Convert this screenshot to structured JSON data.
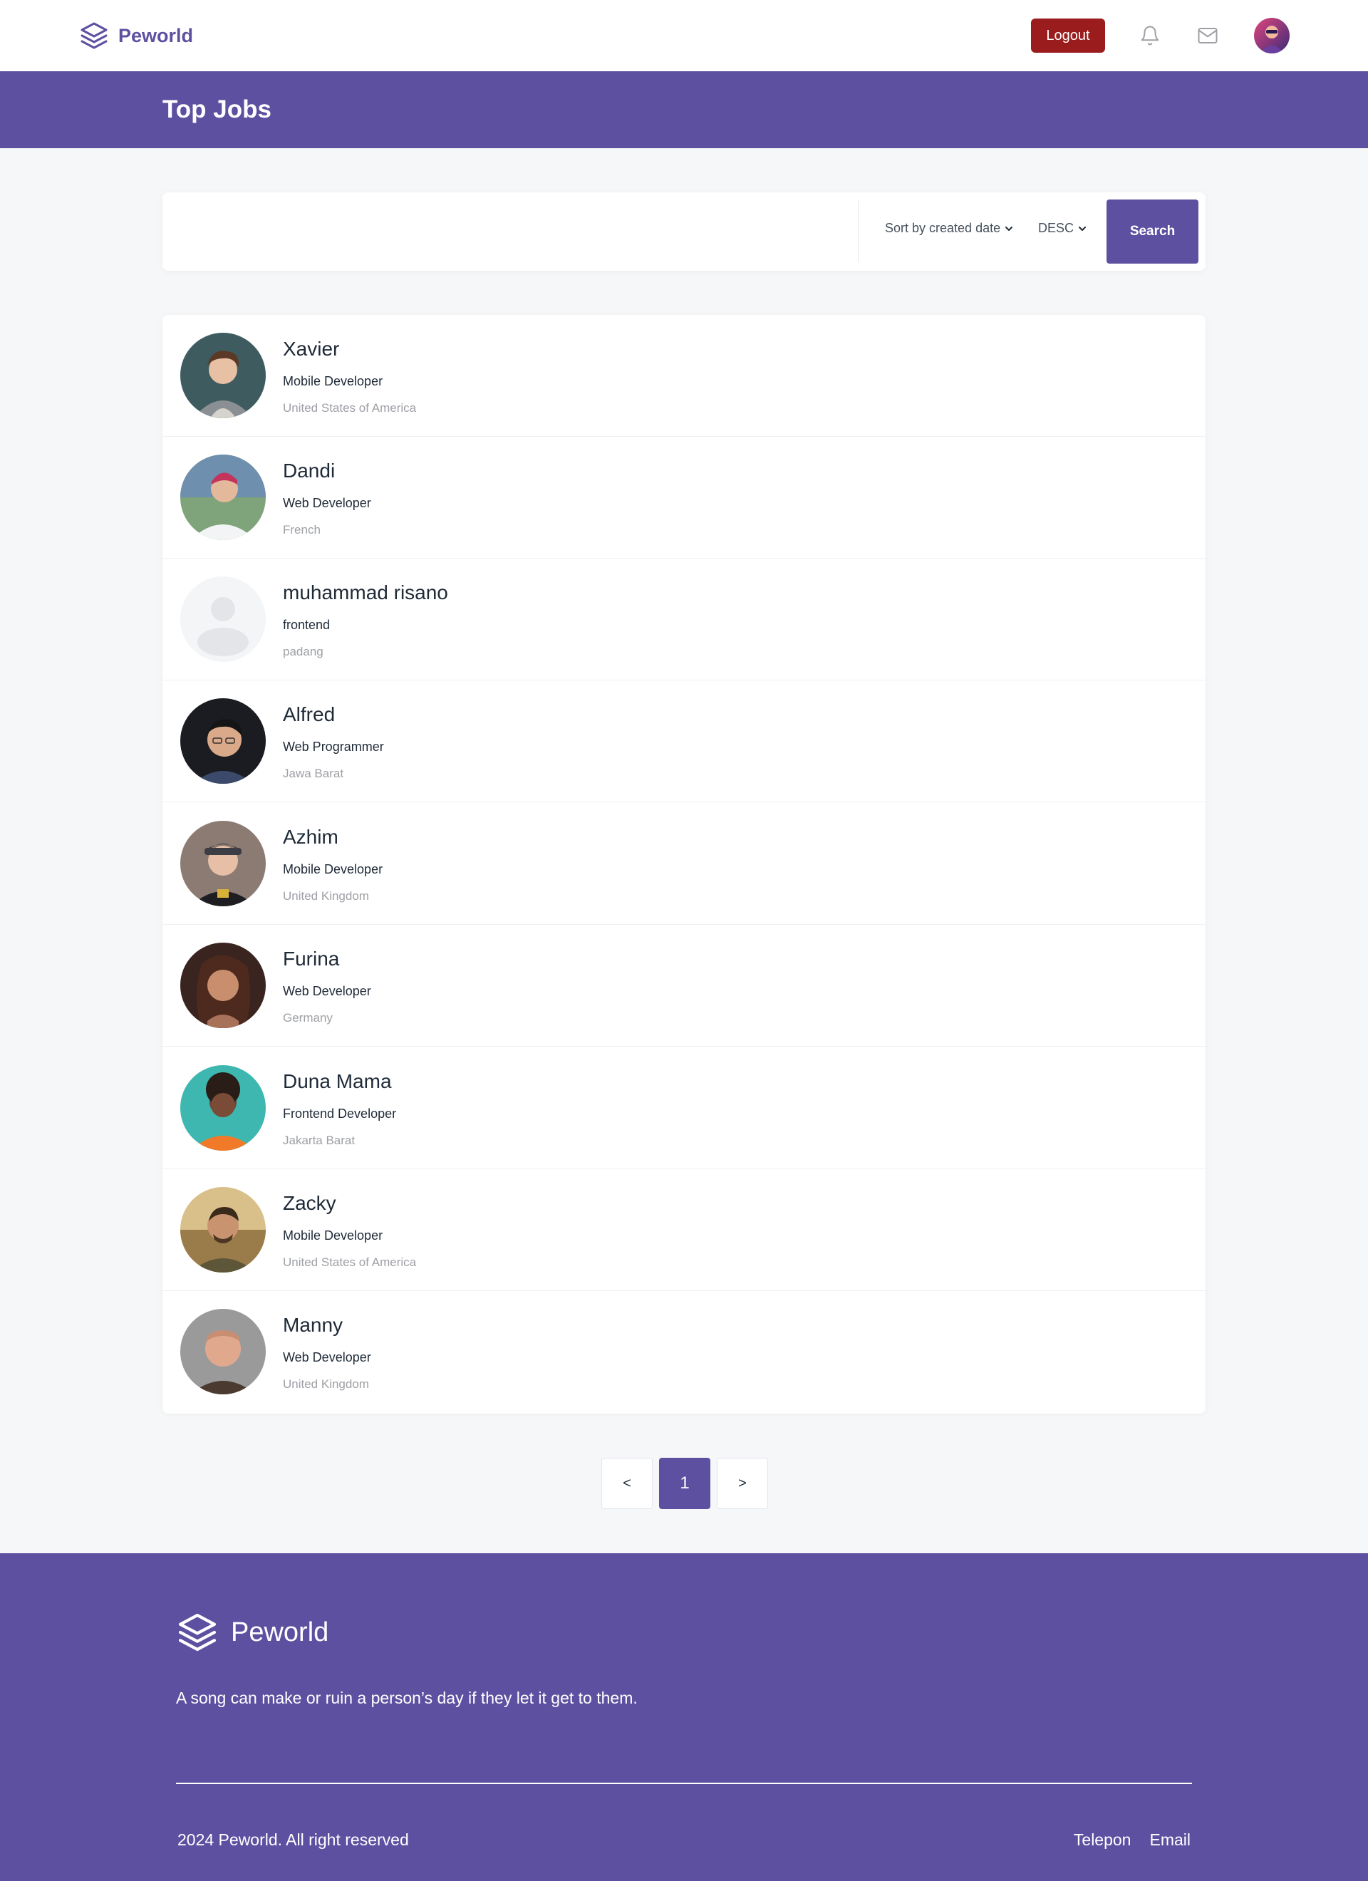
{
  "navbar": {
    "brand": "Peworld",
    "logout_label": "Logout",
    "icons": [
      "layers-icon",
      "bell-icon",
      "mail-icon"
    ]
  },
  "header": {
    "title": "Top Jobs"
  },
  "search": {
    "placeholder": "",
    "value": "",
    "sort_label": "Sort by created date",
    "order_label": "DESC",
    "button_label": "Search"
  },
  "talents": [
    {
      "name": "Xavier",
      "job": "Mobile Developer",
      "location": "United States of America"
    },
    {
      "name": "Dandi",
      "job": "Web Developer",
      "location": "French"
    },
    {
      "name": "muhammad risano",
      "job": "frontend",
      "location": "padang"
    },
    {
      "name": "Alfred",
      "job": "Web Programmer",
      "location": "Jawa Barat"
    },
    {
      "name": "Azhim",
      "job": "Mobile Developer",
      "location": "United Kingdom"
    },
    {
      "name": "Furina",
      "job": "Web Developer",
      "location": "Germany"
    },
    {
      "name": "Duna Mama",
      "job": "Frontend Developer",
      "location": "Jakarta Barat"
    },
    {
      "name": "Zacky",
      "job": "Mobile Developer",
      "location": "United States of America"
    },
    {
      "name": "Manny",
      "job": "Web Developer",
      "location": "United Kingdom"
    }
  ],
  "pagination": {
    "prev": "<",
    "current": "1",
    "next": ">"
  },
  "footer": {
    "brand": "Peworld",
    "tagline": "A song can make or ruin a person’s day if they let it get to them.",
    "copyright": "2024 Peworld. All right reserved",
    "links": [
      "Telepon",
      "Email"
    ]
  },
  "colors": {
    "primary": "#5E50A1",
    "logout": "#9B1C1C",
    "background": "#F6F7F8"
  }
}
